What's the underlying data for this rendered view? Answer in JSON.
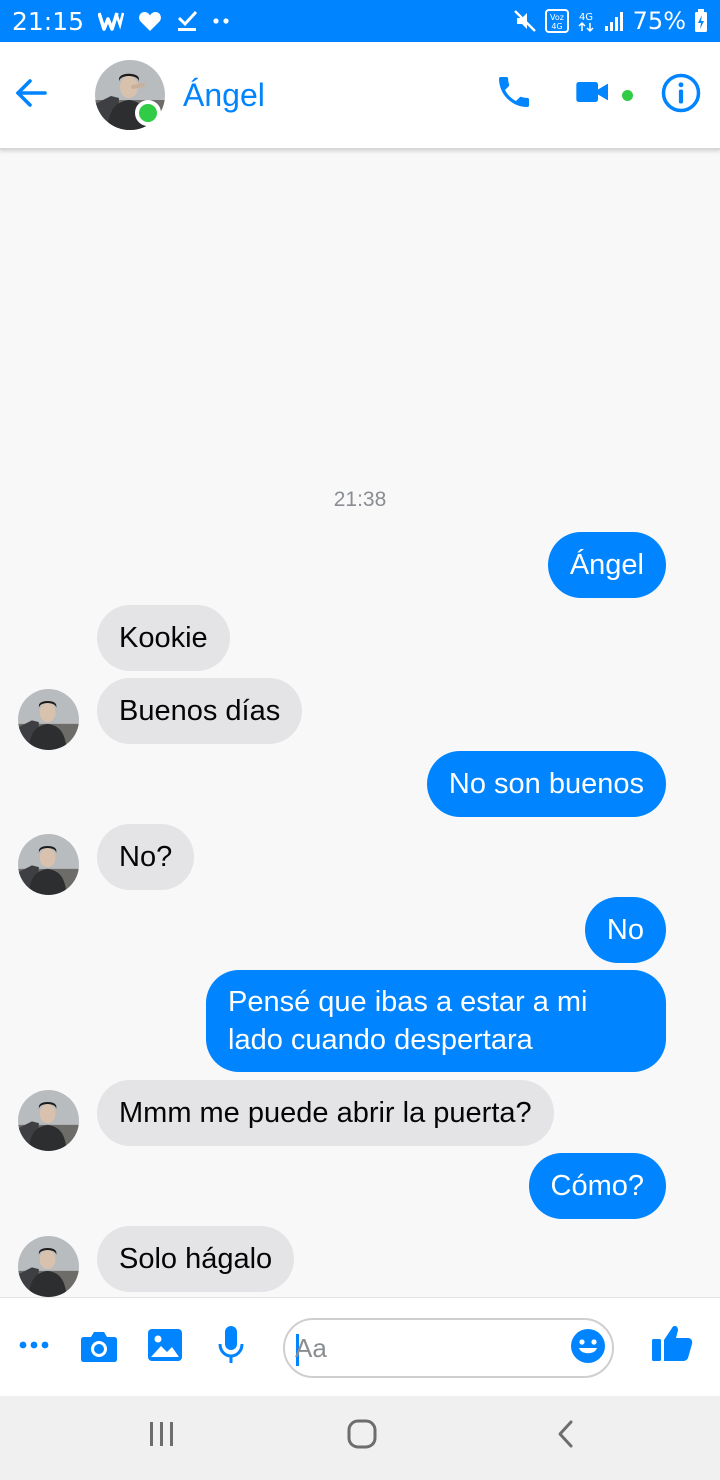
{
  "status_bar": {
    "time": "21:15",
    "battery": "75%",
    "left_icons": [
      "w-logo-icon",
      "heart-icon",
      "check-download-icon",
      "more-dots-icon"
    ],
    "right_icons": [
      "mute-icon",
      "volte-icon",
      "network-4g-icon",
      "signal-icon",
      "battery-charging-icon"
    ]
  },
  "header": {
    "contact_name": "Ángel",
    "online": true,
    "icons": [
      "back-arrow-icon",
      "phone-icon",
      "video-camera-icon",
      "info-icon"
    ]
  },
  "conversation": {
    "timestamp": "21:38",
    "messages": [
      {
        "sender": "me",
        "text": "Ángel"
      },
      {
        "sender": "them",
        "text": "Kookie"
      },
      {
        "sender": "them",
        "text": "Buenos días"
      },
      {
        "sender": "me",
        "text": "No son buenos"
      },
      {
        "sender": "them",
        "text": "No?"
      },
      {
        "sender": "me",
        "text": "No"
      },
      {
        "sender": "me",
        "text": "Pensé que ibas a estar a mi lado cuando despertara"
      },
      {
        "sender": "them",
        "text": "Mmm me puede abrir la puerta?"
      },
      {
        "sender": "me",
        "text": "Cómo?"
      },
      {
        "sender": "them",
        "text": "Solo hágalo"
      }
    ]
  },
  "composer": {
    "placeholder": "Aa",
    "value": "",
    "icons": [
      "more-actions-icon",
      "camera-icon",
      "gallery-icon",
      "microphone-icon",
      "emoji-icon",
      "like-icon"
    ]
  },
  "colors": {
    "accent": "#0084ff",
    "incoming_bubble": "#e4e4e6",
    "online": "#31cc46"
  }
}
